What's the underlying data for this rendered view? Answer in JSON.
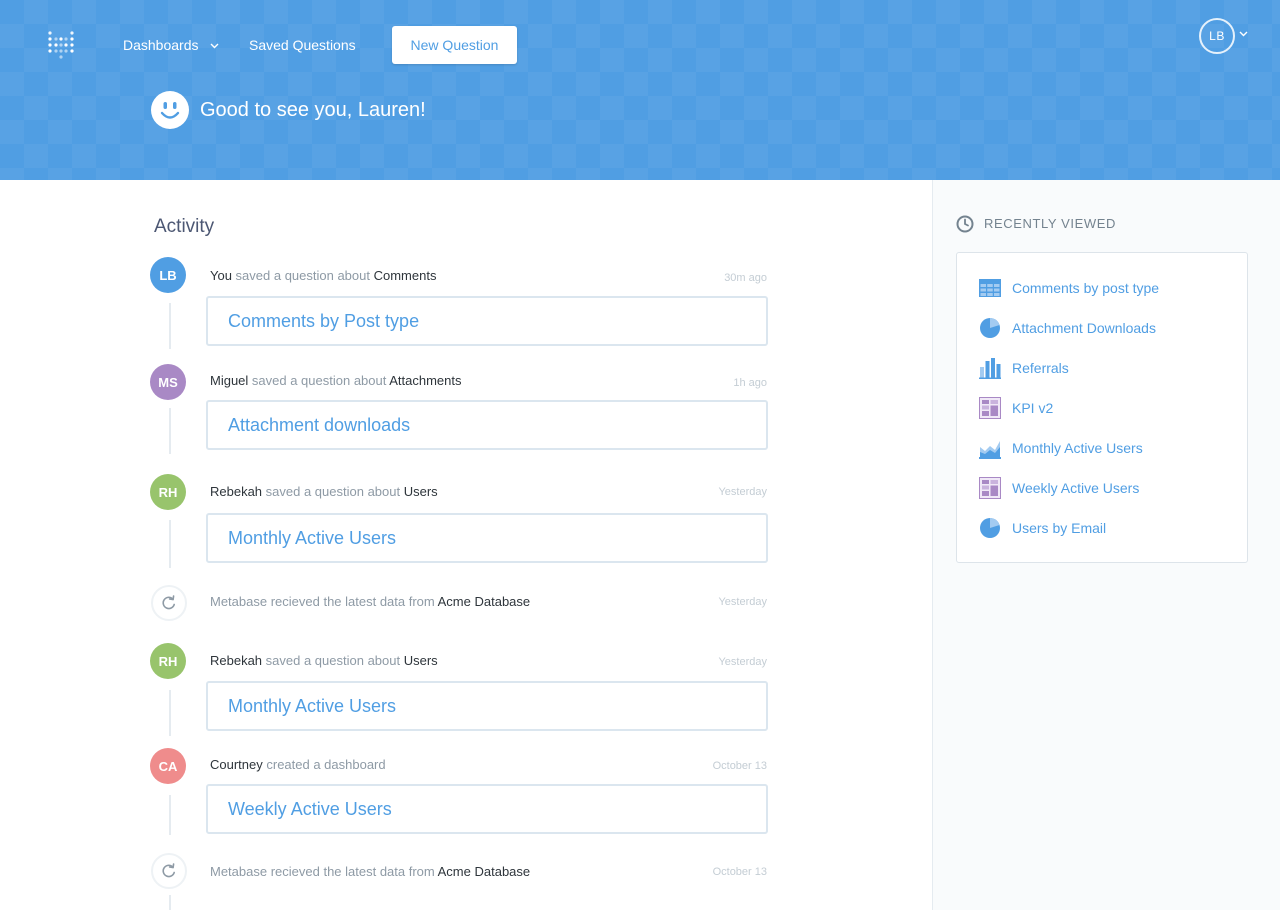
{
  "nav": {
    "dashboards": "Dashboards",
    "saved_questions": "Saved Questions",
    "new_question": "New Question",
    "profile_initials": "LB"
  },
  "greeting": "Good to see you, Lauren!",
  "activity": {
    "title": "Activity",
    "events": [
      {
        "initials": "LB",
        "avatar_color": "#509ee3",
        "actor": "You",
        "action": " saved a question about ",
        "object": "Comments",
        "time": "30m ago",
        "card": "Comments by Post type"
      },
      {
        "initials": "MS",
        "avatar_color": "#a989c5",
        "actor": "Miguel",
        "action": " saved a question about ",
        "object": "Attachments",
        "time": "1h ago",
        "card": "Attachment downloads"
      },
      {
        "initials": "RH",
        "avatar_color": "#98c46c",
        "actor": "Rebekah",
        "action": " saved a question about ",
        "object": "Users",
        "time": "Yesterday",
        "card": "Monthly Active Users"
      },
      {
        "actor": "",
        "action": "Metabase recieved the latest data from ",
        "object": "Acme Database",
        "time": "Yesterday"
      },
      {
        "initials": "RH",
        "avatar_color": "#98c46c",
        "actor": "Rebekah",
        "action": " saved a question about ",
        "object": "Users",
        "time": "Yesterday",
        "card": "Monthly Active Users"
      },
      {
        "initials": "CA",
        "avatar_color": "#ef8c8c",
        "actor": "Courtney",
        "action": " created a dashboard",
        "object": "",
        "time": "October 13",
        "card": "Weekly Active Users"
      },
      {
        "actor": "",
        "action": "Metabase recieved the latest data from ",
        "object": "Acme Database",
        "time": "October 13"
      }
    ]
  },
  "recently_viewed": {
    "title": "RECENTLY VIEWED",
    "items": [
      {
        "label": "Comments by post type",
        "icon": "table-icon"
      },
      {
        "label": "Attachment Downloads",
        "icon": "pie-icon"
      },
      {
        "label": "Referrals",
        "icon": "bar-icon"
      },
      {
        "label": "KPI v2",
        "icon": "dashboard-icon"
      },
      {
        "label": "Monthly Active Users",
        "icon": "area-icon"
      },
      {
        "label": "Weekly Active Users",
        "icon": "dashboard-icon"
      },
      {
        "label": "Users by Email",
        "icon": "pie-icon"
      }
    ]
  },
  "colors": {
    "brand": "#509ee3",
    "text_dark": "#2e353b",
    "text_medium": "#74838f",
    "text_light": "#c4cdd4",
    "dashboard_purple": "#a989c5"
  }
}
